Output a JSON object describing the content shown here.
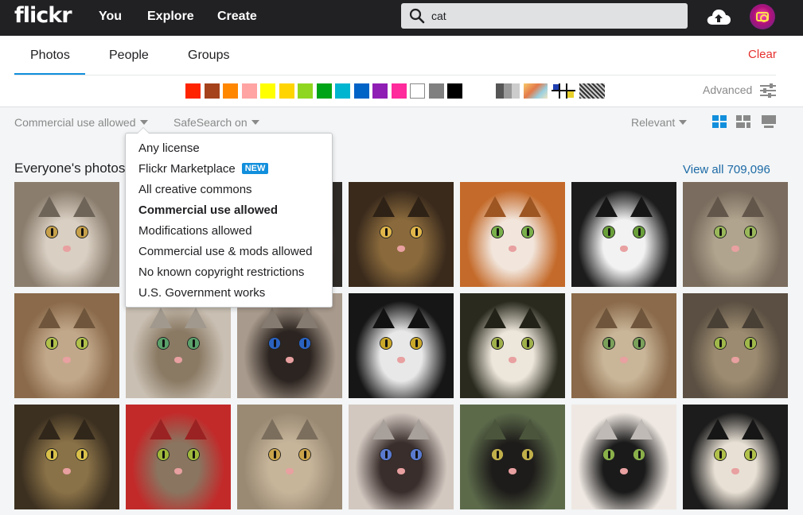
{
  "nav": {
    "logo": "flickr",
    "links": [
      "You",
      "Explore",
      "Create"
    ]
  },
  "search": {
    "value": "cat",
    "placeholder": ""
  },
  "tabs": [
    {
      "label": "Photos",
      "active": true
    },
    {
      "label": "People",
      "active": false
    },
    {
      "label": "Groups",
      "active": false
    }
  ],
  "clear_label": "Clear",
  "colors": [
    "#ff2400",
    "#a5421b",
    "#ff8700",
    "#ffa3a3",
    "#ffff00",
    "#ffd400",
    "#8fd620",
    "#00a517",
    "#00b5d0",
    "#0063c6",
    "#8f1eb4",
    "#ff2a9b",
    "#ffffff",
    "#808080",
    "#000000"
  ],
  "advanced_label": "Advanced",
  "filters": {
    "license": "Commercial use allowed",
    "safesearch": "SafeSearch on",
    "sort": "Relevant"
  },
  "license_menu": [
    {
      "label": "Any license",
      "selected": false,
      "badge": ""
    },
    {
      "label": "Flickr Marketplace",
      "selected": false,
      "badge": "NEW"
    },
    {
      "label": "All creative commons",
      "selected": false,
      "badge": ""
    },
    {
      "label": "Commercial use allowed",
      "selected": true,
      "badge": ""
    },
    {
      "label": "Modifications allowed",
      "selected": false,
      "badge": ""
    },
    {
      "label": "Commercial use & mods allowed",
      "selected": false,
      "badge": ""
    },
    {
      "label": "No known copyright restrictions",
      "selected": false,
      "badge": ""
    },
    {
      "label": "U.S. Government works",
      "selected": false,
      "badge": ""
    }
  ],
  "results": {
    "title": "Everyone's photos",
    "view_all": "View all 709,096"
  },
  "photos": [
    [
      "#8a7d6e",
      "#d9cfc2",
      "#c7a14a"
    ],
    [
      "#4b3d33",
      "#9a8f80",
      "#6a8a3a"
    ],
    [
      "#2e2a26",
      "#7a6a52",
      "#c7b34a"
    ],
    [
      "#3a2a1c",
      "#8a6a3c",
      "#e0b64a"
    ],
    [
      "#c46a2a",
      "#f2e6dc",
      "#7ab04a"
    ],
    [
      "#1c1c1c",
      "#f2f2f2",
      "#6aa03a"
    ],
    [
      "#7a6c5e",
      "#b0a48e",
      "#9ab85a"
    ],
    [
      "#8a6a4a",
      "#c2a88a",
      "#b0c04a"
    ],
    [
      "#c9bfb2",
      "#8a7a64",
      "#5aa06a"
    ],
    [
      "#a89a8c",
      "#2c2420",
      "#2a62c0"
    ],
    [
      "#161616",
      "#e8e8e8",
      "#caa82a"
    ],
    [
      "#2a2a1e",
      "#ede6da",
      "#a0b04a"
    ],
    [
      "#8a6a4a",
      "#c9b598",
      "#7aa05a"
    ],
    [
      "#5a4f42",
      "#9c8b70",
      "#a0b84a"
    ],
    [
      "#3c3020",
      "#8a7248",
      "#d8c04a"
    ],
    [
      "#c22a2a",
      "#8a7560",
      "#a0b83a"
    ],
    [
      "#9a8a74",
      "#c7b59a",
      "#caa44a"
    ],
    [
      "#d2c8c0",
      "#3a2e2c",
      "#5a7ad0"
    ],
    [
      "#5c6a4a",
      "#1e1c1a",
      "#c0b04a"
    ],
    [
      "#efe8e2",
      "#1a1a1a",
      "#8ab04a"
    ],
    [
      "#1c1c1c",
      "#e8e0d4",
      "#b0c04a"
    ]
  ]
}
